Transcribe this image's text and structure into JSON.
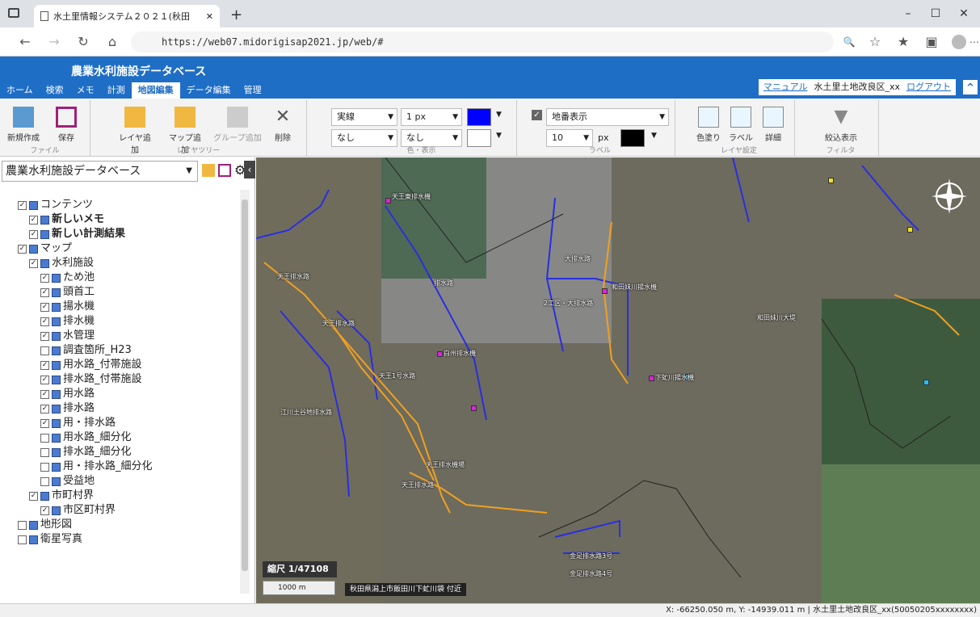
{
  "browser": {
    "tab_title": "水土里情報システム２０２１(秋田",
    "url": "https://web07.midorigisap2021.jp/web/#"
  },
  "app": {
    "title": "農業水利施設データベース",
    "menu": [
      "ホーム",
      "検索",
      "メモ",
      "計測",
      "地図編集",
      "データ編集",
      "管理"
    ],
    "manual": "マニュアル",
    "user": "水土里土地改良区_xx",
    "logout": "ログアウト"
  },
  "ribbon": {
    "file": {
      "label": "ファイル",
      "new": "新規作成",
      "save": "保存"
    },
    "layertree": {
      "label": "レイヤツリー",
      "add_layer": "レイヤ追加",
      "add_map": "マップ追加",
      "add_group": "グループ追加",
      "delete": "削除"
    },
    "style": {
      "label": "色・表示",
      "line": "実線",
      "width": "1 px",
      "fill": "なし",
      "fill2": "なし",
      "line_color": "#0000ff",
      "fill_color": "#ffffff"
    },
    "labels": {
      "label": "ラベル",
      "field": "地番表示",
      "size": "10",
      "unit": "px",
      "color": "#000000"
    },
    "layerset": {
      "label": "レイヤ設定",
      "paint": "色塗り",
      "lbl": "ラベル",
      "detail": "詳細"
    },
    "filter": {
      "label": "フィルタ",
      "narrow": "絞込表示"
    }
  },
  "panel": {
    "database": "農業水利施設データベース",
    "tree": [
      {
        "t": "コンテンツ",
        "i": 1,
        "c": true
      },
      {
        "t": "新しいメモ",
        "i": 2,
        "c": true,
        "b": true
      },
      {
        "t": "新しい計測結果",
        "i": 2,
        "c": true,
        "b": true
      },
      {
        "t": "マップ",
        "i": 1,
        "c": true
      },
      {
        "t": "水利施設",
        "i": 2,
        "c": true
      },
      {
        "t": "ため池",
        "i": 3,
        "c": true
      },
      {
        "t": "頭首工",
        "i": 3,
        "c": true
      },
      {
        "t": "揚水機",
        "i": 3,
        "c": true
      },
      {
        "t": "排水機",
        "i": 3,
        "c": true
      },
      {
        "t": "水管理",
        "i": 3,
        "c": true
      },
      {
        "t": "調査箇所_H23",
        "i": 3,
        "c": false
      },
      {
        "t": "用水路_付帯施設",
        "i": 3,
        "c": true
      },
      {
        "t": "排水路_付帯施設",
        "i": 3,
        "c": true
      },
      {
        "t": "用水路",
        "i": 3,
        "c": true
      },
      {
        "t": "排水路",
        "i": 3,
        "c": true
      },
      {
        "t": "用・排水路",
        "i": 3,
        "c": true
      },
      {
        "t": "用水路_細分化",
        "i": 3,
        "c": false
      },
      {
        "t": "排水路_細分化",
        "i": 3,
        "c": false
      },
      {
        "t": "用・排水路_細分化",
        "i": 3,
        "c": false
      },
      {
        "t": "受益地",
        "i": 3,
        "c": false
      },
      {
        "t": "市町村界",
        "i": 2,
        "c": true
      },
      {
        "t": "市区町村界",
        "i": 3,
        "c": true
      },
      {
        "t": "地形図",
        "i": 1,
        "c": false
      },
      {
        "t": "衛星写真",
        "i": 1,
        "c": false
      }
    ]
  },
  "map": {
    "scale": "縮尺 1/47108",
    "scalebar": "1000 m",
    "place": "秋田県潟上市飯田川下虻川袋 付近",
    "labels": [
      "天王東排水機",
      "排水路",
      "天王排水路",
      "天王排水路",
      "天王1号水路",
      "白州排水機",
      "江川土谷地排水路",
      "大排水路",
      "2工区・大排水路",
      "和田妹川揚水機",
      "下虻川揚水機",
      "和田妹川大堤",
      "金足排水路3号",
      "金足排水路4号",
      "天王排水機場",
      "天王排水路"
    ]
  },
  "status": {
    "coords": "X: -66250.050 m, Y: -14939.011 m",
    "user": "水土里土地改良区_xx(50050205xxxxxxxx)"
  }
}
